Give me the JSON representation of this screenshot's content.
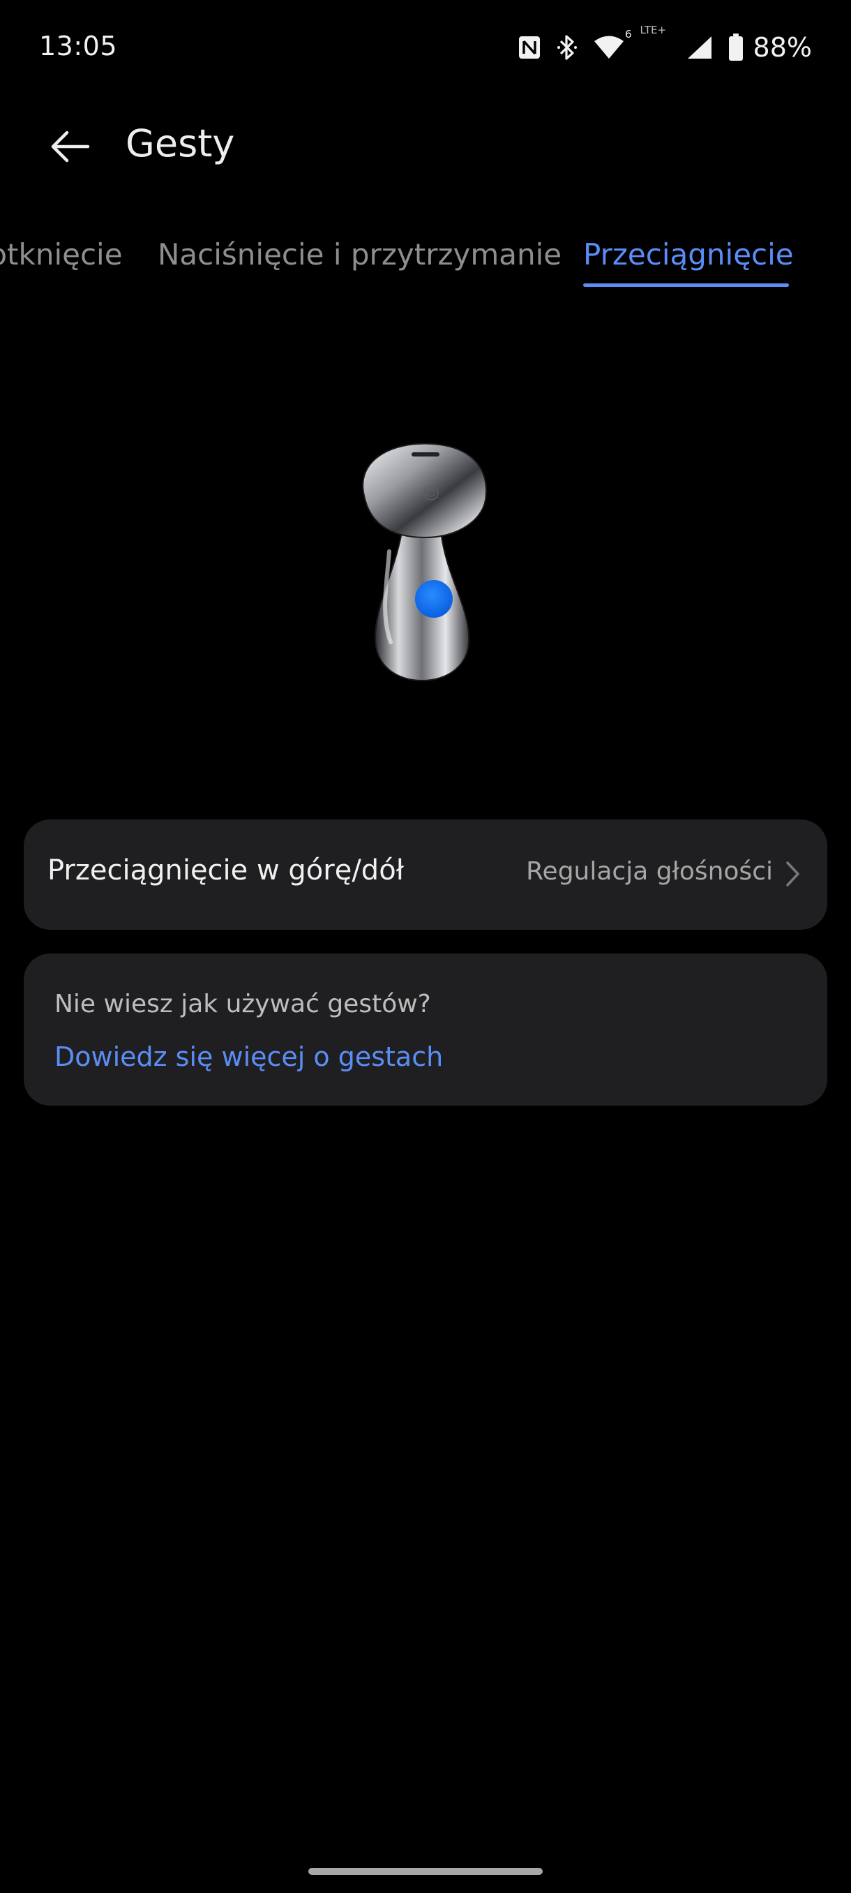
{
  "status_bar": {
    "time": "13:05",
    "network_label": "LTE+",
    "wifi_badge": "6",
    "battery": "88%",
    "icons": [
      "nfc-icon",
      "bluetooth-icon",
      "wifi-icon",
      "signal-icon",
      "battery-icon"
    ]
  },
  "header": {
    "title": "Gesty"
  },
  "tabs": [
    {
      "label": "Dotknięcie",
      "selected": false
    },
    {
      "label": "Naciśnięcie i przytrzymanie",
      "selected": false
    },
    {
      "label": "Przeciągnięcie",
      "selected": true
    }
  ],
  "setting": {
    "label": "Przeciągnięcie w górę/dół",
    "value": "Regulacja głośności"
  },
  "help": {
    "question": "Nie wiesz jak używać gestów?",
    "link": "Dowiedz się więcej o gestach"
  },
  "colors": {
    "accent": "#5b8df7",
    "card": "#1f1f21",
    "background": "#000000",
    "gesture_dot": "#0a6cff"
  }
}
